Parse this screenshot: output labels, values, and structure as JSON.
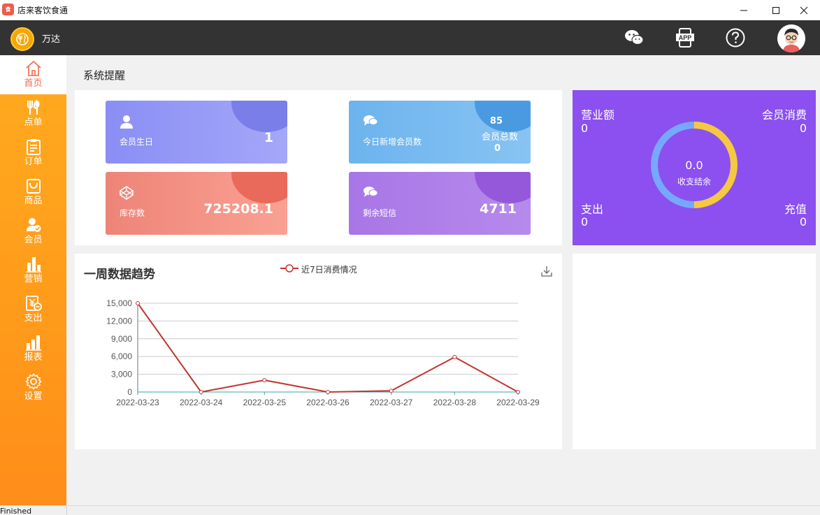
{
  "window": {
    "title": "店来客饮食通",
    "logo_text": "食"
  },
  "header": {
    "store_name": "万达"
  },
  "sidebar": {
    "items": [
      {
        "label": "首页",
        "icon": "home-icon"
      },
      {
        "label": "点单",
        "icon": "utensils-icon"
      },
      {
        "label": "订单",
        "icon": "clipboard-icon"
      },
      {
        "label": "商品",
        "icon": "bag-icon"
      },
      {
        "label": "会员",
        "icon": "member-icon"
      },
      {
        "label": "营销",
        "icon": "bar-chart-icon"
      },
      {
        "label": "支出",
        "icon": "expense-icon"
      },
      {
        "label": "报表",
        "icon": "report-icon"
      },
      {
        "label": "设置",
        "icon": "gear-icon"
      }
    ]
  },
  "main": {
    "section_title": "系统提醒",
    "cards": {
      "birthday": {
        "label": "会员生日",
        "value": "1"
      },
      "new_members": {
        "label": "今日新增会员数",
        "value": "85",
        "sublabel": "会员总数",
        "subvalue": "0"
      },
      "stock": {
        "label": "库存数",
        "value": "725208.1"
      },
      "sms": {
        "label": "剩余短信",
        "value": "4711"
      }
    },
    "stats": {
      "revenue_label": "营业额",
      "revenue_value": "0",
      "member_spend_label": "会员消费",
      "member_spend_value": "0",
      "expense_label": "支出",
      "expense_value": "0",
      "recharge_label": "充值",
      "recharge_value": "0",
      "center_value": "0.0",
      "center_label": "收支结余",
      "ring_colors": {
        "a": "#f5c842",
        "b": "#77a8ff"
      }
    },
    "trend": {
      "title": "一周数据趋势"
    }
  },
  "chart_data": {
    "type": "line",
    "categories": [
      "2022-03-23",
      "2022-03-24",
      "2022-03-25",
      "2022-03-26",
      "2022-03-27",
      "2022-03-28",
      "2022-03-29"
    ],
    "series": [
      {
        "name": "近7日消费情况",
        "values": [
          15000,
          0,
          2000,
          0,
          200,
          5900,
          0
        ],
        "color": "#c23531"
      }
    ],
    "yticks": [
      "0",
      "3,000",
      "6,000",
      "9,000",
      "12,000",
      "15,000"
    ],
    "ylim": [
      0,
      15000
    ],
    "grid": true,
    "legend": "top-center"
  },
  "status": {
    "text": "Finished"
  }
}
